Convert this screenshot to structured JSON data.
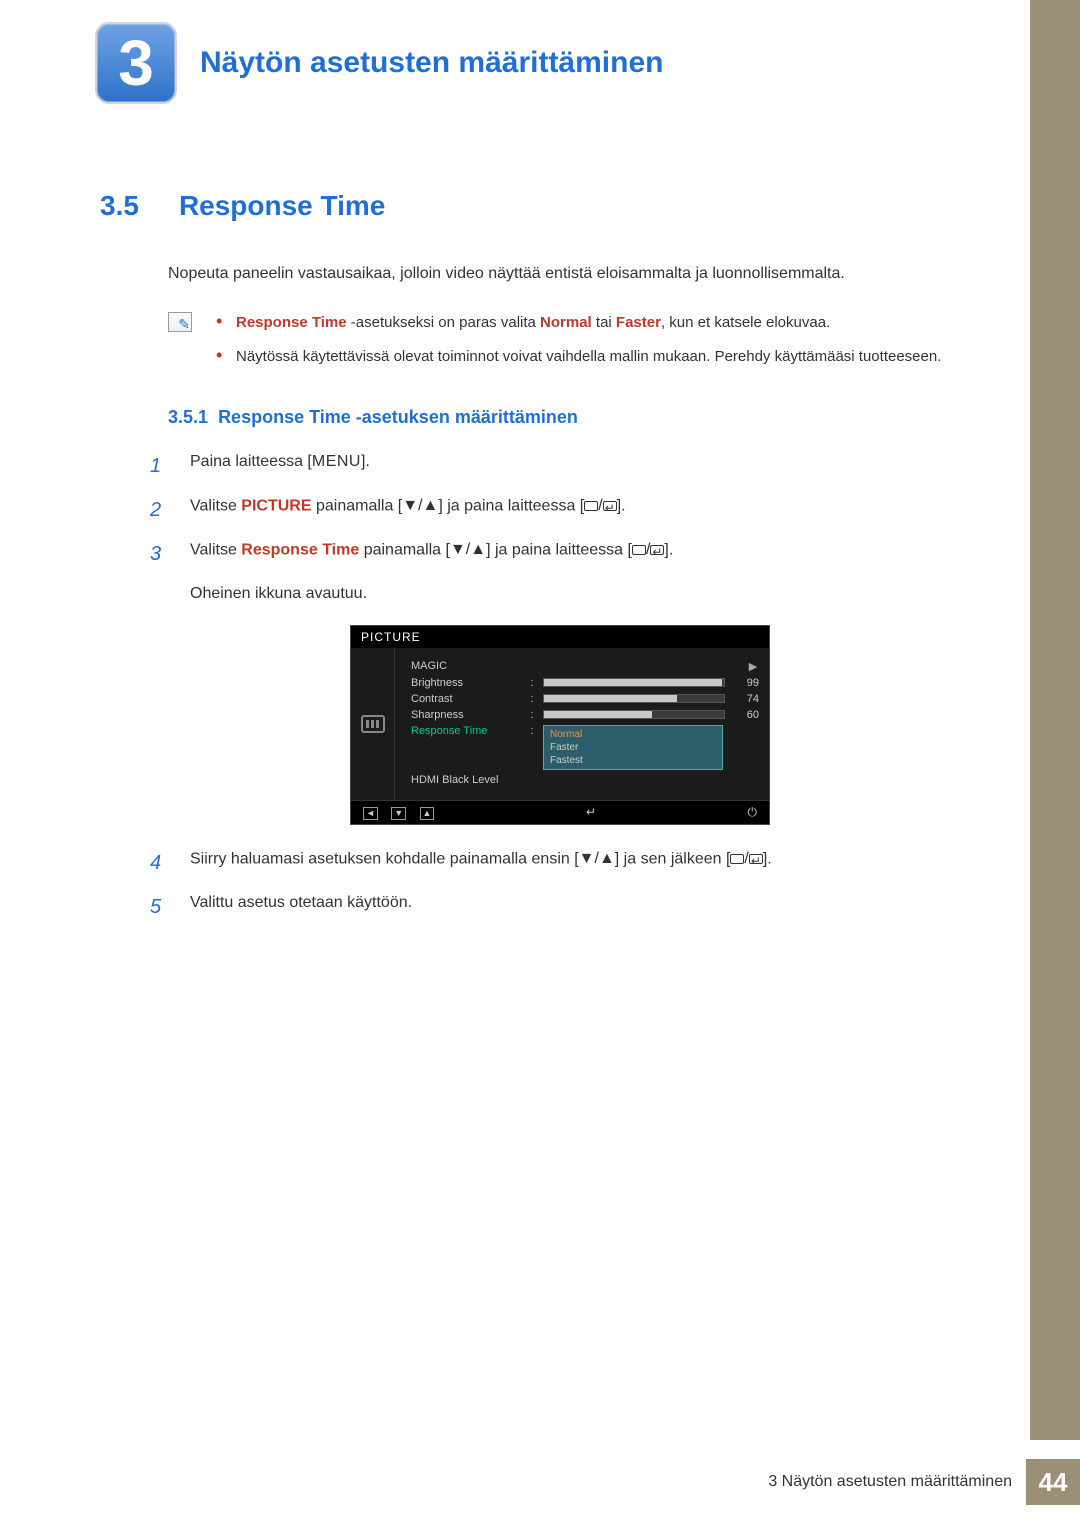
{
  "chapter": {
    "number": "3",
    "title": "Näytön asetusten määrittäminen"
  },
  "section": {
    "number": "3.5",
    "title": "Response Time",
    "intro": "Nopeuta paneelin vastausaikaa, jolloin video näyttää entistä eloisammalta ja luonnollisemmalta."
  },
  "note": {
    "b1_pre": "Response Time",
    "b1_mid": " -asetukseksi on paras valita ",
    "b1_opt1": "Normal",
    "b1_or": " tai ",
    "b1_opt2": "Faster",
    "b1_post": ", kun et katsele elokuvaa.",
    "b2": "Näytössä käytettävissä olevat toiminnot voivat vaihdella mallin mukaan. Perehdy käyttämääsi tuotteeseen."
  },
  "subsection": {
    "number": "3.5.1",
    "title": "Response Time -asetuksen määrittäminen"
  },
  "steps": {
    "s1_pre": "Paina laitteessa [",
    "s1_btn": "MENU",
    "s1_post": "].",
    "s2_pre": "Valitse ",
    "s2_key": "PICTURE",
    "s2_mid": " painamalla [",
    "s2_post": "] ja paina laitteessa [",
    "s2_end": "].",
    "s3_pre": "Valitse ",
    "s3_key": "Response Time",
    "s3_mid": " painamalla [",
    "s3_post": "] ja paina laitteessa [",
    "s3_end": "].",
    "s3_extra": "Oheinen ikkuna avautuu.",
    "s4_pre": "Siirry haluamasi asetuksen kohdalle painamalla ensin [",
    "s4_mid": "] ja sen jälkeen [",
    "s4_end": "].",
    "s5": "Valittu asetus otetaan käyttöön."
  },
  "osd": {
    "title": "PICTURE",
    "items": {
      "magic": "MAGIC",
      "brightness": "Brightness",
      "contrast": "Contrast",
      "sharpness": "Sharpness",
      "response": "Response Time",
      "hdmi": "HDMI Black Level"
    },
    "values": {
      "brightness": "99",
      "contrast": "74",
      "sharpness": "60"
    },
    "options": {
      "normal": "Normal",
      "faster": "Faster",
      "fastest": "Fastest"
    },
    "nav": {
      "back": "◄",
      "down": "▼",
      "up": "▲",
      "enter": "↵",
      "power": "⏻"
    }
  },
  "footer": {
    "text": "3 Näytön asetusten määrittäminen",
    "page": "44"
  },
  "chart_data": {
    "type": "table",
    "title": "PICTURE OSD settings",
    "rows": [
      {
        "label": "Brightness",
        "value": 99
      },
      {
        "label": "Contrast",
        "value": 74
      },
      {
        "label": "Sharpness",
        "value": 60
      }
    ],
    "response_time_options": [
      "Normal",
      "Faster",
      "Fastest"
    ],
    "response_time_selected": "Normal"
  }
}
